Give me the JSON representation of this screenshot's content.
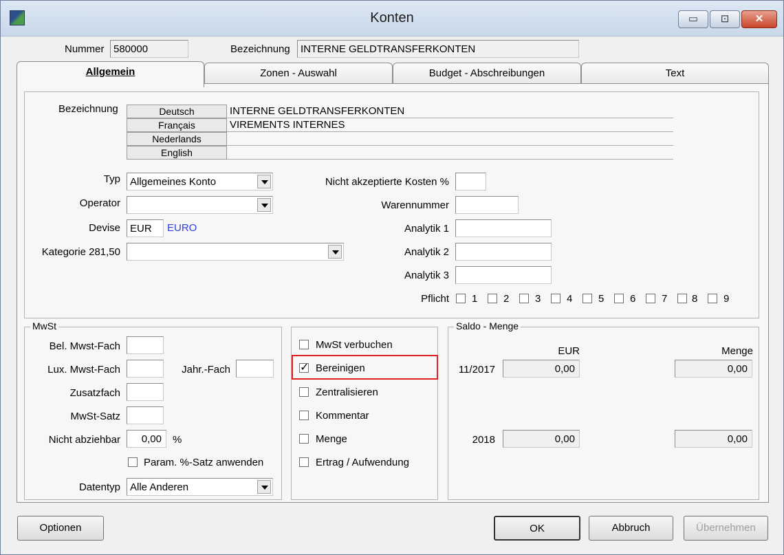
{
  "window": {
    "title": "Konten"
  },
  "titlebar_buttons": {
    "minimize": "▭",
    "maximize": "⊡",
    "close": "✕"
  },
  "header": {
    "nummer_label": "Nummer",
    "nummer_value": "580000",
    "bezeichnung_label": "Bezeichnung",
    "bezeichnung_value": "INTERNE GELDTRANSFERKONTEN"
  },
  "tabs": [
    {
      "label": "Allgemein"
    },
    {
      "label": "Zonen - Auswahl"
    },
    {
      "label": "Budget - Abschreibungen"
    },
    {
      "label": "Text"
    }
  ],
  "general": {
    "bezeichnung_label": "Bezeichnung",
    "languages": [
      {
        "lang": "Deutsch",
        "value": "INTERNE GELDTRANSFERKONTEN"
      },
      {
        "lang": "Français",
        "value": "VIREMENTS INTERNES"
      },
      {
        "lang": "Nederlands",
        "value": ""
      },
      {
        "lang": "English",
        "value": ""
      }
    ],
    "typ_label": "Typ",
    "typ_value": "Allgemeines Konto",
    "operator_label": "Operator",
    "operator_value": "",
    "devise_label": "Devise",
    "devise_code": "EUR",
    "devise_name": "EURO",
    "kategorie_label": "Kategorie 281,50",
    "kategorie_value": "",
    "nicht_akzeptiert_label": "Nicht akzeptierte Kosten %",
    "nicht_akzeptiert_value": "",
    "warennummer_label": "Warennummer",
    "warennummer_value": "",
    "analytik1_label": "Analytik 1",
    "analytik2_label": "Analytik 2",
    "analytik3_label": "Analytik 3",
    "pflicht_label": "Pflicht",
    "pflicht_boxes": [
      "1",
      "2",
      "3",
      "4",
      "5",
      "6",
      "7",
      "8",
      "9"
    ]
  },
  "mwst": {
    "group_title": "MwSt",
    "bel_label": "Bel. Mwst-Fach",
    "lux_label": "Lux. Mwst-Fach",
    "jahr_label": "Jahr.-Fach",
    "zusatz_label": "Zusatzfach",
    "satz_label": "MwSt-Satz",
    "nicht_abziehbar_label": "Nicht abziehbar",
    "nicht_abziehbar_value": "0,00",
    "percent": "%",
    "param_label": "Param. %-Satz anwenden",
    "datentyp_label": "Datentyp",
    "datentyp_value": "Alle Anderen"
  },
  "options": [
    {
      "label": "MwSt verbuchen",
      "checked": false
    },
    {
      "label": "Bereinigen",
      "checked": true
    },
    {
      "label": "Zentralisieren",
      "checked": false
    },
    {
      "label": "Kommentar",
      "checked": false
    },
    {
      "label": "Menge",
      "checked": false
    },
    {
      "label": "Ertrag / Aufwendung",
      "checked": false
    }
  ],
  "saldo": {
    "group_title": "Saldo - Menge",
    "col_eur": "EUR",
    "col_menge": "Menge",
    "rows": [
      {
        "period": "11/2017",
        "eur": "0,00",
        "menge": "0,00"
      },
      {
        "period": "2018",
        "eur": "0,00",
        "menge": "0,00"
      }
    ]
  },
  "buttons": {
    "optionen": "Optionen",
    "ok": "OK",
    "abbruch": "Abbruch",
    "uebernehmen": "Übernehmen"
  },
  "colors": {
    "link_blue": "#2f3fd8",
    "highlight": "#e02020"
  }
}
